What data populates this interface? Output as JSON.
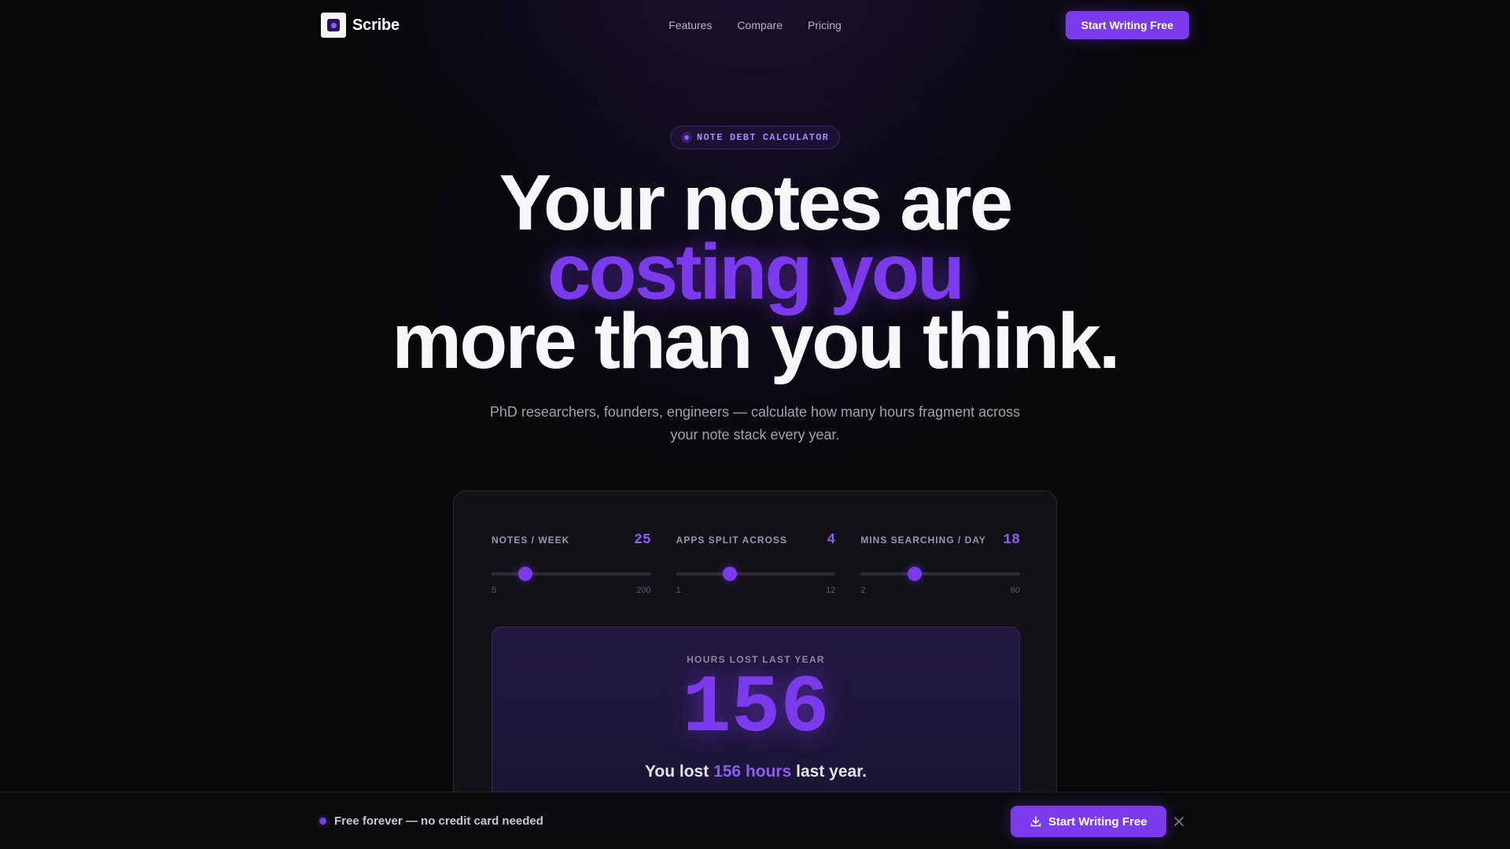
{
  "brand": {
    "name": "Scribe"
  },
  "nav": {
    "links": [
      "Features",
      "Compare",
      "Pricing"
    ],
    "cta_label": "Start Writing Free"
  },
  "hero": {
    "badge": "NOTE DEBT CALCULATOR",
    "headline_line1": "Your notes are",
    "headline_line2": "costing you",
    "headline_line3": "more than you think.",
    "subtitle": "PhD researchers, founders, engineers — calculate how many hours fragment across your note stack every year."
  },
  "calculator": {
    "sliders": [
      {
        "label": "NOTES / WEEK",
        "value": 25,
        "min": 5,
        "max": 200
      },
      {
        "label": "APPS SPLIT ACROSS",
        "value": 4,
        "min": 1,
        "max": 12
      },
      {
        "label": "MINS SEARCHING / DAY",
        "value": 18,
        "min": 2,
        "max": 60
      }
    ],
    "result": {
      "label": "HOURS LOST LAST YEAR",
      "number": "156",
      "line_prefix": "You lost",
      "line_accent": "156 hours",
      "line_suffix": "last year."
    }
  },
  "bottom_bar": {
    "text": "Free forever — no credit card needed",
    "cta_label": "Start Writing Free"
  },
  "colors": {
    "accent": "#7c3aed",
    "background": "#08080b",
    "card": "#121117"
  },
  "icons": {
    "logo": "scribe-logo-icon",
    "badge_dot": "dot-icon",
    "download": "download-icon",
    "close": "close-icon"
  }
}
